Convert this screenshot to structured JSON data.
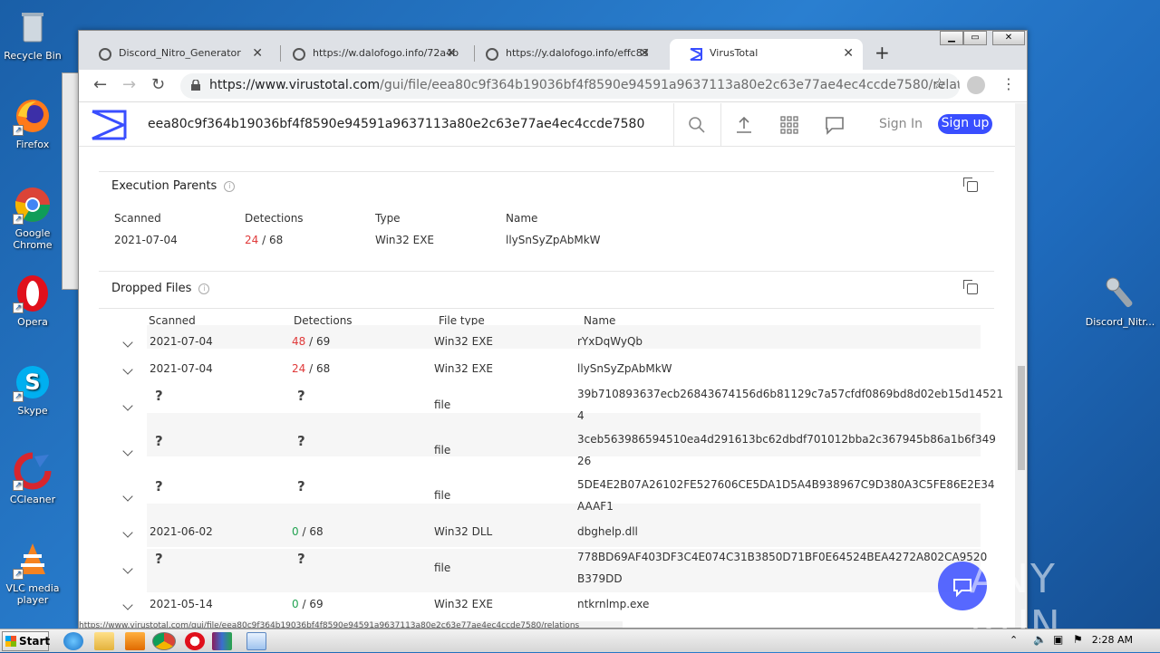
{
  "desktop": {
    "icons": [
      {
        "label": "Recycle Bin"
      },
      {
        "label": "Firefox"
      },
      {
        "label": "Google Chrome"
      },
      {
        "label": "Opera"
      },
      {
        "label": "Skype"
      },
      {
        "label": "CCleaner"
      },
      {
        "label": "VLC media player"
      },
      {
        "label": "Discord_Nitr..."
      }
    ]
  },
  "browser": {
    "tabs": [
      {
        "title": "Discord_Nitro_Generator",
        "close": "✕"
      },
      {
        "title": "https://w.dalofogo.info/72a4b",
        "close": "✕"
      },
      {
        "title": "https://y.dalofogo.info/effc83",
        "close": "✕"
      },
      {
        "title": "VirusTotal",
        "close": "✕"
      }
    ],
    "new_tab": "+",
    "url_host": "https://www.virustotal.com",
    "url_path": "/gui/file/eea80c9f364b19036bf4f8590e94591a9637113a80e2c63e77ae4ec4ccde7580/relations",
    "status_url": "https://www.virustotal.com/gui/file/eea80c9f364b19036bf4f8590e94591a9637113a80e2c63e77ae4ec4ccde7580/relations"
  },
  "vt": {
    "search_value": "eea80c9f364b19036bf4f8590e94591a9637113a80e2c63e77ae4ec4ccde7580",
    "sign_in": "Sign In",
    "sign_up": "Sign up",
    "execution_parents": {
      "title": "Execution Parents",
      "headers": [
        "Scanned",
        "Detections",
        "Type",
        "Name"
      ],
      "rows": [
        {
          "scanned": "2021-07-04",
          "det": "24",
          "total": "/ 68",
          "type": "Win32 EXE",
          "name": "llySnSyZpAbMkW"
        }
      ]
    },
    "dropped_files": {
      "title": "Dropped Files",
      "headers": [
        "Scanned",
        "Detections",
        "File type",
        "Name"
      ],
      "rows": [
        {
          "scanned": "2021-07-04",
          "det": "48",
          "total": "/ 69",
          "type": "Win32 EXE",
          "name1": "rYxDqWyQb",
          "name2": ""
        },
        {
          "scanned": "2021-07-04",
          "det": "24",
          "total": "/ 68",
          "type": "Win32 EXE",
          "name1": "llySnSyZpAbMkW",
          "name2": ""
        },
        {
          "scanned": "?",
          "det": "?",
          "total": "",
          "type": "file",
          "name1": "39b710893637ecb26843674156d6b81129c7a57cfdf0869bd8d02eb15d14521",
          "name2": "4"
        },
        {
          "scanned": "?",
          "det": "?",
          "total": "",
          "type": "file",
          "name1": "3ceb563986594510ea4d291613bc62dbdf701012bba2c367945b86a1b6f349",
          "name2": "26"
        },
        {
          "scanned": "?",
          "det": "?",
          "total": "",
          "type": "file",
          "name1": "5DE4E2B07A26102FE527606CE5DA1D5A4B938967C9D380A3C5FE86E2E34",
          "name2": "AAAF1"
        },
        {
          "scanned": "2021-06-02",
          "det": "0",
          "total": "/ 68",
          "type": "Win32 DLL",
          "name1": "dbghelp.dll",
          "name2": ""
        },
        {
          "scanned": "?",
          "det": "?",
          "total": "",
          "type": "file",
          "name1": "778BD69AF403DF3C4E074C31B3850D71BF0E64524BEA4272A802CA9520",
          "name2": "B379DD"
        },
        {
          "scanned": "2021-05-14",
          "det": "0",
          "total": "/ 69",
          "type": "Win32 EXE",
          "name1": "ntkrnlmp.exe",
          "name2": ""
        }
      ]
    }
  },
  "taskbar": {
    "start": "Start",
    "clock": "2:28 AM"
  },
  "watermark": "ANY RUN"
}
